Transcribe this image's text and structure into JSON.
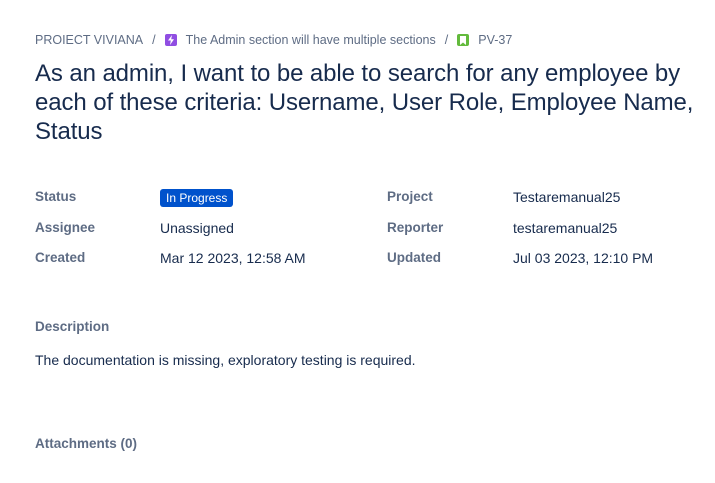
{
  "breadcrumb": {
    "project": "PROIECT VIVIANA",
    "separator": "/",
    "epic": "The Admin section will have multiple sections",
    "issue_key": "PV-37"
  },
  "issue": {
    "title": "As an admin, I want to be able to search for any employee by each of these criteria: Username, User Role, Employee Name, Status"
  },
  "fields": {
    "status_label": "Status",
    "status_value": "In Progress",
    "project_label": "Project",
    "project_value": "Testaremanual25",
    "assignee_label": "Assignee",
    "assignee_value": "Unassigned",
    "reporter_label": "Reporter",
    "reporter_value": "testaremanual25",
    "created_label": "Created",
    "created_value": "Mar 12 2023, 12:58 AM",
    "updated_label": "Updated",
    "updated_value": "Jul 03 2023, 12:10 PM"
  },
  "description": {
    "label": "Description",
    "text": "The documentation is missing, exploratory testing is required."
  },
  "attachments": {
    "label": "Attachments (0)"
  },
  "colors": {
    "status_badge": "#0052cc",
    "epic_icon": "#904ee2",
    "story_icon": "#63ba3c",
    "label_text": "#5e6c84",
    "body_text": "#172b4d"
  },
  "icons": {
    "epic": "epic-lightning-icon",
    "story": "story-bookmark-icon"
  }
}
